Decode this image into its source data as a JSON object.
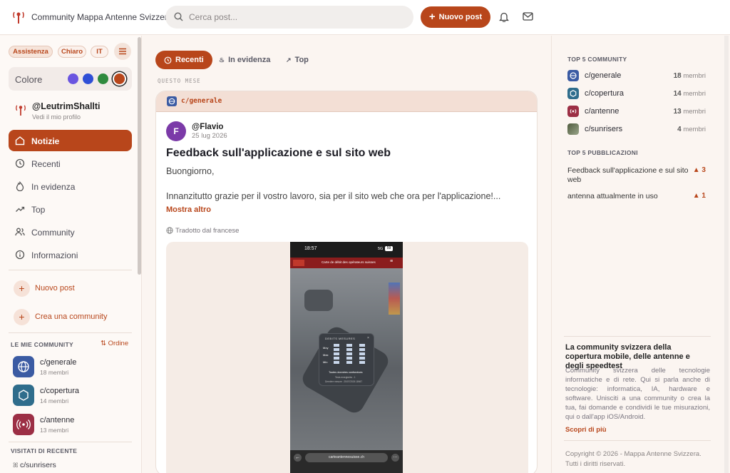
{
  "header": {
    "brand": "Community Mappa Antenne Svizzera",
    "search_placeholder": "Cerca post...",
    "new_post_label": "Nuovo post",
    "icons": [
      "search-icon",
      "plus-icon",
      "bell-icon",
      "mail-icon"
    ]
  },
  "sidebar": {
    "pills": [
      "Assistenza",
      "Chiaro",
      "IT"
    ],
    "color_label": "Colore",
    "colors": [
      "#6a55e0",
      "#2f4fd6",
      "#2f8a3e",
      "#b8461b"
    ],
    "user": {
      "name": "@LeutrimShallti",
      "sub": "Vedi il mio profilo"
    },
    "nav": [
      {
        "label": "Notizie",
        "icon": "home-icon",
        "active": true
      },
      {
        "label": "Recenti",
        "icon": "clock-icon"
      },
      {
        "label": "In evidenza",
        "icon": "flame-icon"
      },
      {
        "label": "Top",
        "icon": "trending-icon"
      },
      {
        "label": "Community",
        "icon": "users-icon"
      },
      {
        "label": "Informazioni",
        "icon": "info-icon"
      }
    ],
    "actions": [
      "Nuovo post",
      "Crea una community"
    ],
    "my_communities_title": "LE MIE COMMUNITY",
    "order_label": "Ordine",
    "communities": [
      {
        "name": "c/generale",
        "members": "18 membri",
        "color": "#3b5ba3"
      },
      {
        "name": "c/copertura",
        "members": "14 membri",
        "color": "#2f6d8c"
      },
      {
        "name": "c/antenne",
        "members": "13 membri",
        "color": "#9c2f45"
      }
    ],
    "recent_title": "VISITATI DI RECENTE",
    "recent": [
      "c/sunrisers"
    ]
  },
  "feed": {
    "tabs": [
      "Recenti",
      "In evidenza",
      "Top"
    ],
    "period": "QUESTO MESE",
    "post": {
      "community": "c/generale",
      "avatar": "F",
      "author": "@Flavio",
      "date": "25 lug 2026",
      "title": "Feedback sull'applicazione e sul sito web",
      "body1": "Buongiorno,",
      "body2": "Innanzitutto grazie per il vostro lavoro, sia per il sito web che ora per l'applicazione!...",
      "more": "Mostra altro",
      "translated": "Tradotto dal francese",
      "screenshot": {
        "time": "18:57",
        "status": "5G",
        "battery": "59",
        "banner": "Carte de débit des opérateurs suisses",
        "card_title": "DEBITS MESURES",
        "rows": [
          "Moy",
          "Max",
          "Min"
        ],
        "card_line1": "Toutes données confondues",
        "card_line2": "Tests enregistrés : 1",
        "card_line3": "Dernière mesure : 25/07/2026 18h57",
        "url": "carteantennesuisse.ch"
      }
    }
  },
  "right": {
    "top_comm_title": "TOP 5 COMMUNITY",
    "members_label": "membri",
    "top_comm": [
      {
        "name": "c/generale",
        "count": "18",
        "color": "#3b5ba3"
      },
      {
        "name": "c/copertura",
        "count": "14",
        "color": "#2f6d8c"
      },
      {
        "name": "c/antenne",
        "count": "13",
        "color": "#9c2f45"
      },
      {
        "name": "c/sunrisers",
        "count": "4",
        "color": "#6f7a5e"
      }
    ],
    "top_pub_title": "TOP 5 PUBBLICAZIONI",
    "top_pub": [
      {
        "title": "Feedback sull'applicazione e sul sito web",
        "votes": "▲ 3"
      },
      {
        "title": "antenna attualmente in uso",
        "votes": "▲ 1"
      }
    ],
    "about_title": "La community svizzera della copertura mobile, delle antenne e degli speedtest",
    "about_text": "Community svizzera delle tecnologie informatiche e di rete. Qui si parla anche di tecnologie: informatica, IA, hardware e software. Unisciti a una community o crea la tua, fai domande e condividi le tue misurazioni, qui o dall'app iOS/Android.",
    "learn_more": "Scopri di più",
    "copyright": "Copyright © 2026 - Mappa Antenne Svizzera. Tutti i diritti riservati."
  }
}
